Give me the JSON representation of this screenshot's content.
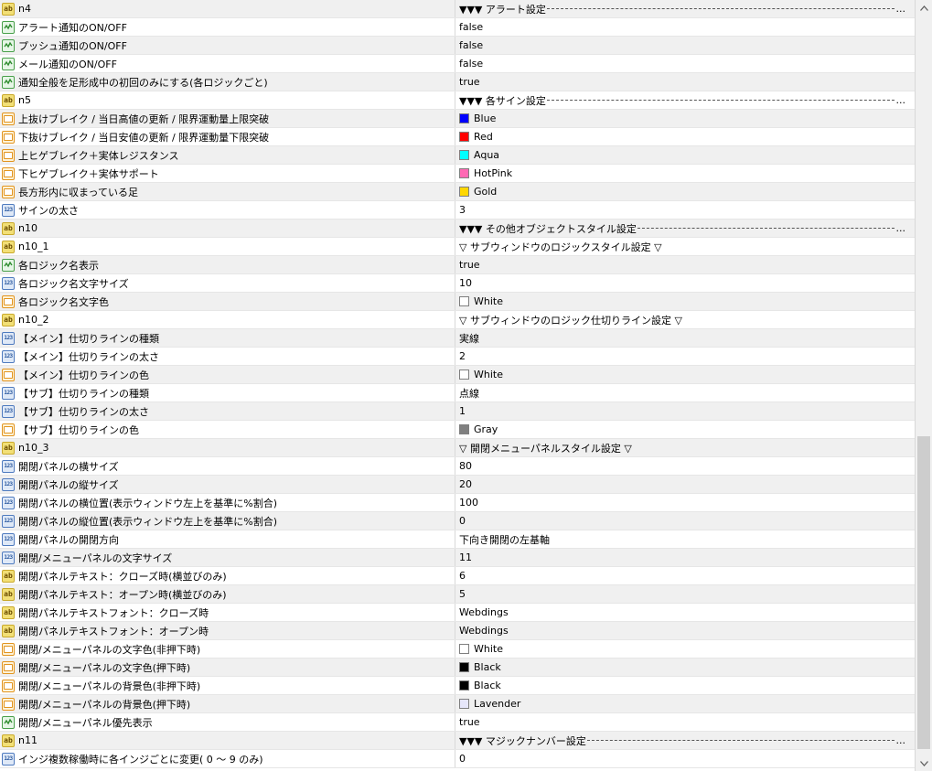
{
  "rows": [
    {
      "name": "n4",
      "value": "▼▼▼ アラート設定",
      "type": "ab",
      "header": true
    },
    {
      "name": "アラート通知のON/OFF",
      "value": "false",
      "type": "bool"
    },
    {
      "name": "プッシュ通知のON/OFF",
      "value": "false",
      "type": "bool"
    },
    {
      "name": "メール通知のON/OFF",
      "value": "false",
      "type": "bool"
    },
    {
      "name": "通知全般を足形成中の初回のみにする(各ロジックごと)",
      "value": "true",
      "type": "bool"
    },
    {
      "name": "n5",
      "value": "▼▼▼ 各サイン設定",
      "type": "ab",
      "header": true
    },
    {
      "name": "上抜けブレイク / 当日高値の更新 / 限界運動量上限突破",
      "value": "Blue",
      "type": "color",
      "swatch": "#0000ff"
    },
    {
      "name": "下抜けブレイク / 当日安値の更新 / 限界運動量下限突破",
      "value": "Red",
      "type": "color",
      "swatch": "#ff0000"
    },
    {
      "name": "上ヒゲブレイク＋実体レジスタンス",
      "value": "Aqua",
      "type": "color",
      "swatch": "#00ffff"
    },
    {
      "name": "下ヒゲブレイク＋実体サポート",
      "value": "HotPink",
      "type": "color",
      "swatch": "#ff69b4"
    },
    {
      "name": "長方形内に収まっている足",
      "value": "Gold",
      "type": "color",
      "swatch": "#ffd700"
    },
    {
      "name": "サインの太さ",
      "value": "3",
      "type": "num"
    },
    {
      "name": "n10",
      "value": "▼▼▼ その他オブジェクトスタイル設定",
      "type": "ab",
      "header": true
    },
    {
      "name": "n10_1",
      "value": "▽ サブウィンドウのロジックスタイル設定 ▽",
      "type": "ab"
    },
    {
      "name": "各ロジック名表示",
      "value": "true",
      "type": "bool"
    },
    {
      "name": "各ロジック名文字サイズ",
      "value": "10",
      "type": "num"
    },
    {
      "name": "各ロジック名文字色",
      "value": "White",
      "type": "color",
      "swatch": "#ffffff"
    },
    {
      "name": "n10_2",
      "value": "▽ サブウィンドウのロジック仕切りライン設定 ▽",
      "type": "ab"
    },
    {
      "name": "【メイン】仕切りラインの種類",
      "value": "実線",
      "type": "num"
    },
    {
      "name": "【メイン】仕切りラインの太さ",
      "value": "2",
      "type": "num"
    },
    {
      "name": "【メイン】仕切りラインの色",
      "value": "White",
      "type": "color",
      "swatch": "#ffffff"
    },
    {
      "name": "【サブ】仕切りラインの種類",
      "value": "点線",
      "type": "num"
    },
    {
      "name": "【サブ】仕切りラインの太さ",
      "value": "1",
      "type": "num"
    },
    {
      "name": "【サブ】仕切りラインの色",
      "value": "Gray",
      "type": "color",
      "swatch": "#808080"
    },
    {
      "name": "n10_3",
      "value": "▽ 開閉メニューパネルスタイル設定 ▽",
      "type": "ab"
    },
    {
      "name": "開閉パネルの横サイズ",
      "value": "80",
      "type": "num"
    },
    {
      "name": "開閉パネルの縦サイズ",
      "value": "20",
      "type": "num"
    },
    {
      "name": "開閉パネルの横位置(表示ウィンドウ左上を基準に%割合)",
      "value": "100",
      "type": "num"
    },
    {
      "name": "開閉パネルの縦位置(表示ウィンドウ左上を基準に%割合)",
      "value": "0",
      "type": "num"
    },
    {
      "name": "開閉パネルの開閉方向",
      "value": "下向き開閉の左基軸",
      "type": "num"
    },
    {
      "name": "開閉/メニューパネルの文字サイズ",
      "value": "11",
      "type": "num"
    },
    {
      "name": "開閉パネルテキスト：クローズ時(横並びのみ)",
      "value": "6",
      "type": "ab"
    },
    {
      "name": "開閉パネルテキスト：オープン時(横並びのみ)",
      "value": "5",
      "type": "ab"
    },
    {
      "name": "開閉パネルテキストフォント：クローズ時",
      "value": "Webdings",
      "type": "ab"
    },
    {
      "name": "開閉パネルテキストフォント：オープン時",
      "value": "Webdings",
      "type": "ab"
    },
    {
      "name": "開閉/メニューパネルの文字色(非押下時)",
      "value": "White",
      "type": "color",
      "swatch": "#ffffff"
    },
    {
      "name": "開閉/メニューパネルの文字色(押下時)",
      "value": "Black",
      "type": "color",
      "swatch": "#000000"
    },
    {
      "name": "開閉/メニューパネルの背景色(非押下時)",
      "value": "Black",
      "type": "color",
      "swatch": "#000000"
    },
    {
      "name": "開閉/メニューパネルの背景色(押下時)",
      "value": "Lavender",
      "type": "color",
      "swatch": "#e6e6fa"
    },
    {
      "name": "開閉/メニューパネル優先表示",
      "value": "true",
      "type": "bool"
    },
    {
      "name": "n11",
      "value": "▼▼▼ マジックナンバー設定",
      "type": "ab",
      "header": true
    },
    {
      "name": "インジ複数稼働時に各インジごとに変更( 0 ～ 9 のみ)",
      "value": "0",
      "type": "num"
    }
  ],
  "scroll": {
    "up_icon": "arrow-up-icon",
    "down_icon": "arrow-down-icon"
  }
}
